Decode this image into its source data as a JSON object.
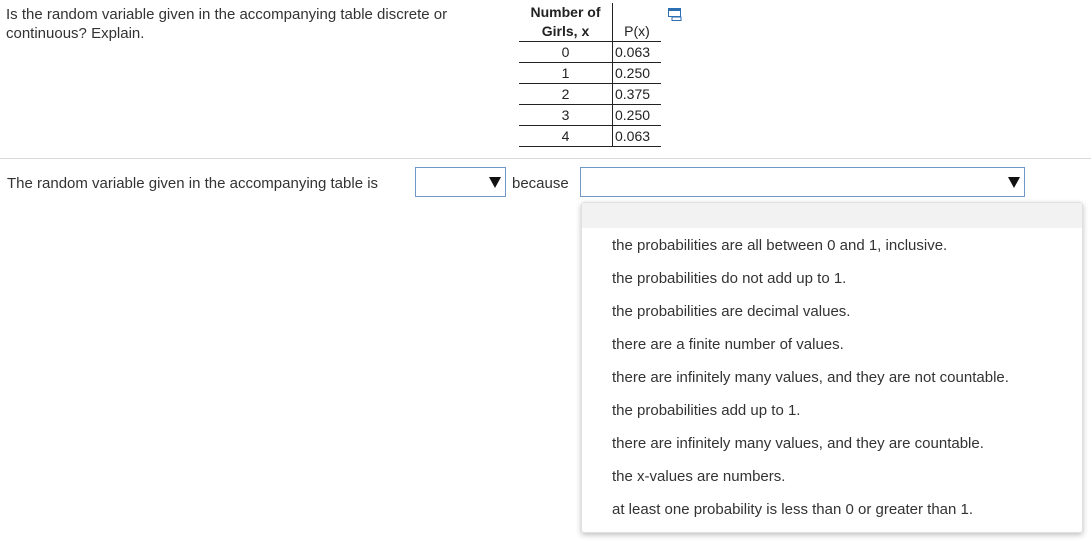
{
  "question": {
    "text": "Is the random variable given in the accompanying table discrete or continuous? Explain."
  },
  "table": {
    "header_x": "Number of\nGirls, x",
    "header_x_line1": "Number of",
    "header_x_line2": "Girls, x",
    "header_p": "P(x)",
    "rows": [
      {
        "x": "0",
        "p": "0.063"
      },
      {
        "x": "1",
        "p": "0.250"
      },
      {
        "x": "2",
        "p": "0.375"
      },
      {
        "x": "3",
        "p": "0.250"
      },
      {
        "x": "4",
        "p": "0.063"
      }
    ]
  },
  "answer": {
    "prefix": "The random variable given in the accompanying table is",
    "select1_value": "",
    "connector": "because",
    "select2_value": ""
  },
  "dropdown": {
    "options": [
      "the probabilities are all between 0 and 1, inclusive.",
      "the probabilities do not add up to 1.",
      "the probabilities are decimal values.",
      "there are a finite number of values.",
      "there are infinitely many values, and they are not countable.",
      "the probabilities add up to 1.",
      "there are infinitely many values, and they are countable.",
      "the x-values are numbers.",
      "at least one probability is less than 0 or greater than 1."
    ]
  },
  "icons": {
    "popout": "popout-window-icon",
    "dropdown_arrow": "chevron-down-icon"
  }
}
